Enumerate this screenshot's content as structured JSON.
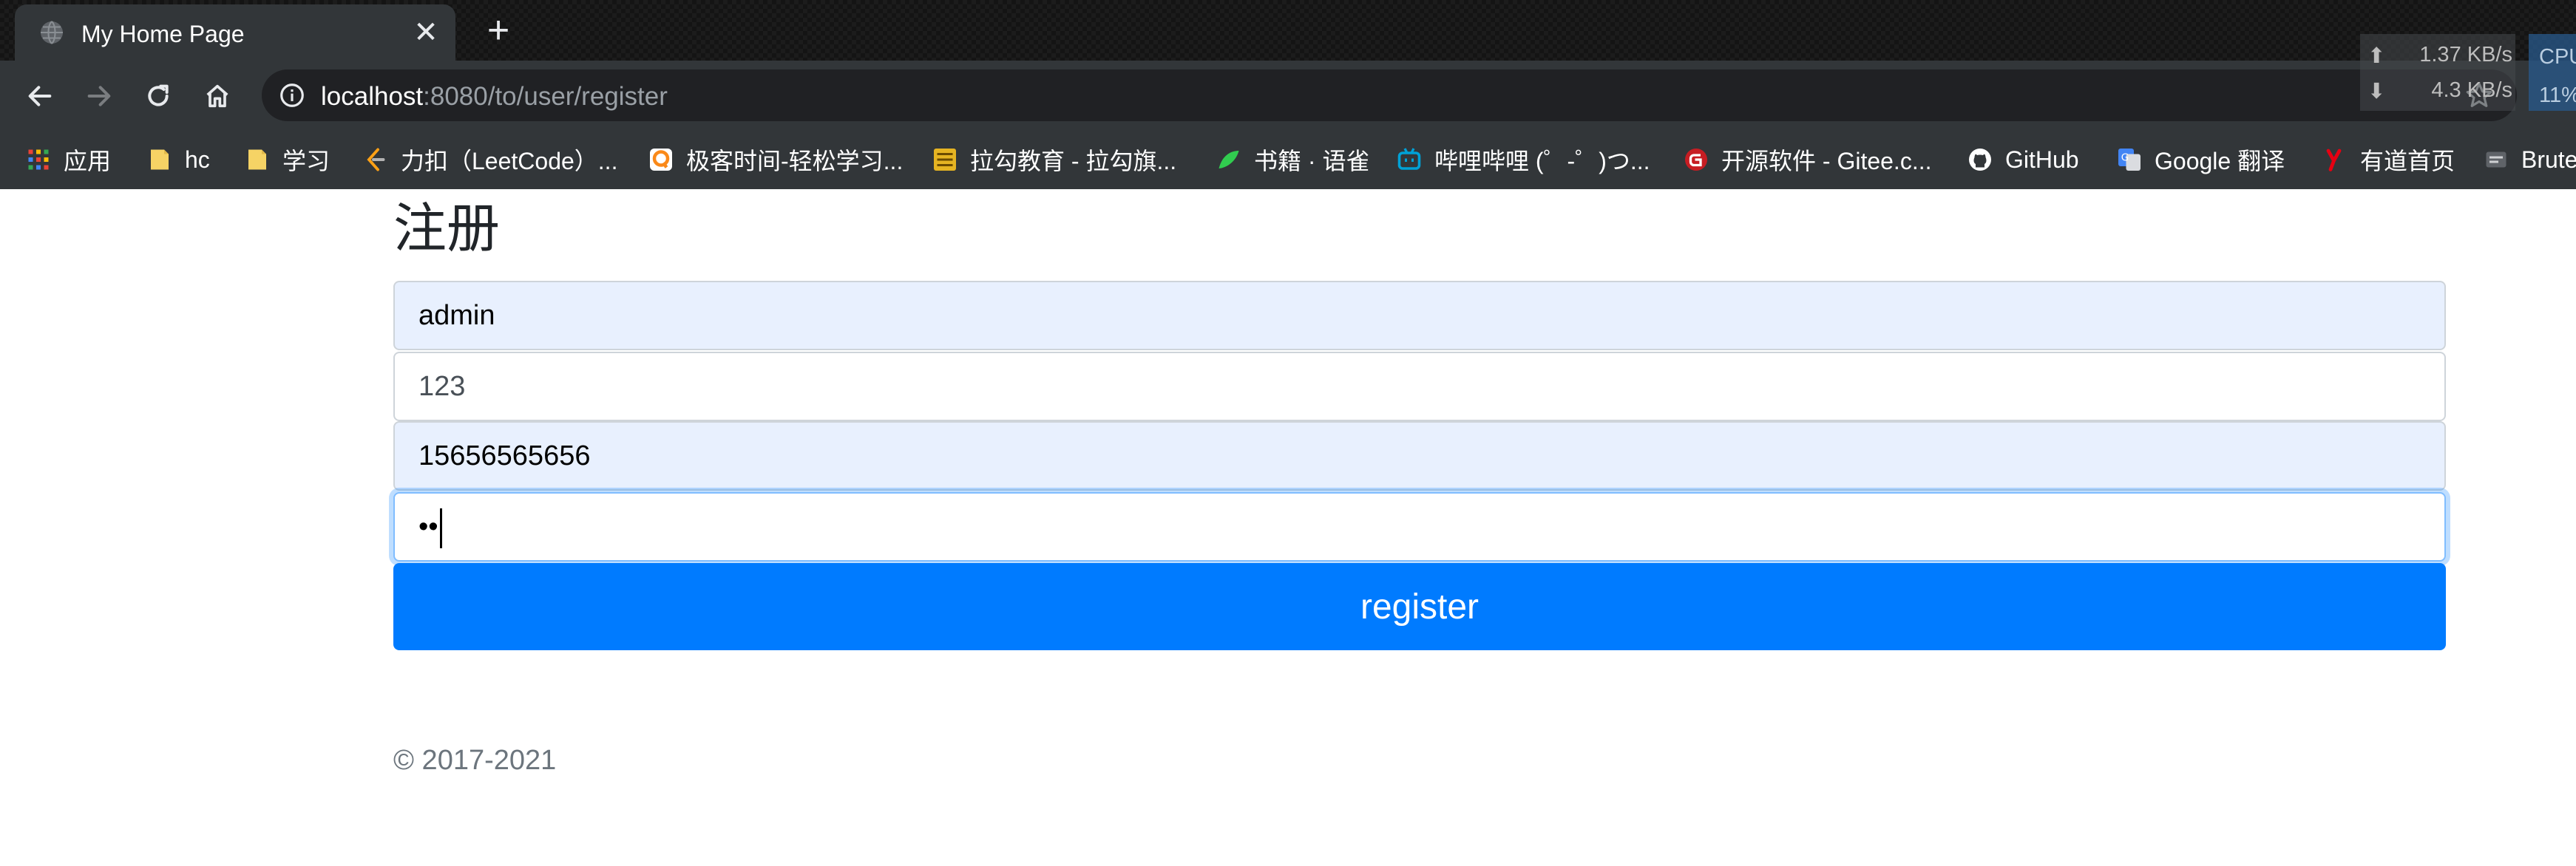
{
  "browser": {
    "tab": {
      "title": "My Home Page",
      "close_glyph": "✕",
      "favicon": "globe-icon"
    },
    "new_tab_glyph": "+",
    "address_bar": {
      "host": "localhost",
      "path": ":8080/to/user/register"
    },
    "net_monitor": {
      "up_arrow": "⬆",
      "up_rate": "1.37 KB/s",
      "down_arrow": "⬇",
      "down_rate": "4.3 KB/s"
    },
    "cpu_monitor": {
      "label": "CPU",
      "value": "11%"
    },
    "bookmarks": [
      {
        "label": "应用",
        "icon": "apps-grid-icon"
      },
      {
        "label": "hc",
        "icon": "folder-icon"
      },
      {
        "label": "学习",
        "icon": "folder-icon"
      },
      {
        "label": "力扣（LeetCode）...",
        "icon": "leetcode-icon"
      },
      {
        "label": "极客时间-轻松学习...",
        "icon": "geektime-icon"
      },
      {
        "label": "拉勾教育 - 拉勾旗...",
        "icon": "lagou-icon"
      },
      {
        "label": "书籍 · 语雀",
        "icon": "yuque-icon"
      },
      {
        "label": "哔哩哔哩 (゜-゜)つ...",
        "icon": "bilibili-icon"
      },
      {
        "label": "开源软件 - Gitee.c...",
        "icon": "gitee-icon"
      },
      {
        "label": "GitHub",
        "icon": "github-icon"
      },
      {
        "label": "Google 翻译",
        "icon": "google-translate-icon"
      },
      {
        "label": "有道首页",
        "icon": "youdao-icon"
      },
      {
        "label": "Brute",
        "icon": "bookmark-icon"
      }
    ]
  },
  "page": {
    "title": "注册",
    "form": {
      "username_value": "admin",
      "password_value": "123",
      "phone_value": "15656565656",
      "confirm_password_mask": "••",
      "submit_label": "register"
    },
    "footer": "© 2017-2021"
  },
  "colors": {
    "primary": "#007bff",
    "autofill_bg": "#e8f0fe",
    "chrome_bg": "#323639",
    "omnibox_bg": "#202124"
  }
}
